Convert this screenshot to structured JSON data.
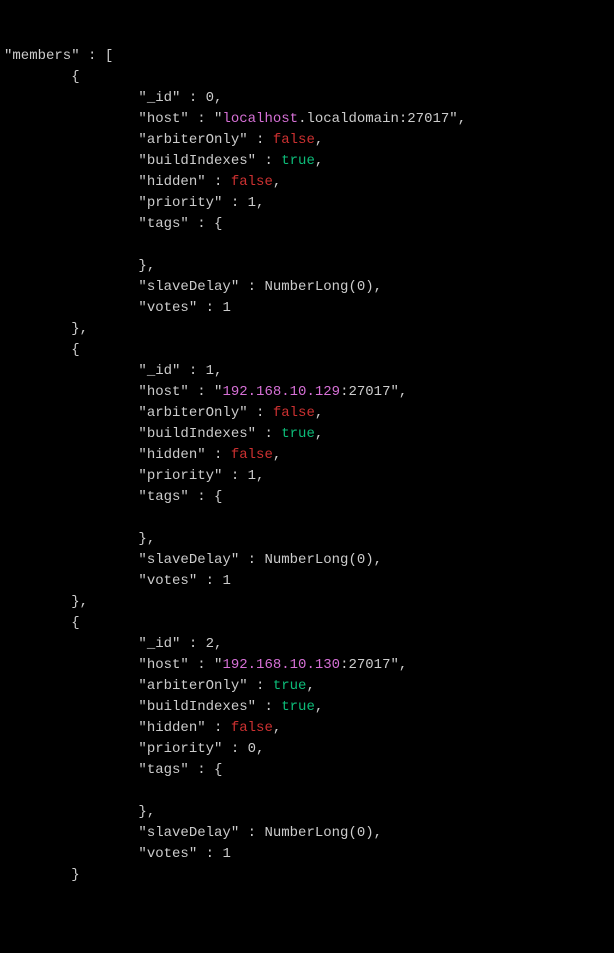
{
  "keyMembers": "\"members\"",
  "bracketOpen": "[",
  "braceOpen": "{",
  "braceClose": "}",
  "braceCloseComma": "},",
  "colon": " : ",
  "comma": ",",
  "numberlongOpen": "NumberLong(",
  "numberlongClose": ")",
  "members": [
    {
      "id_key": "\"_id\"",
      "id_val": "0",
      "host_key": "\"host\"",
      "host_q": "\"",
      "host_main": "localhost",
      "host_tail": ".localdomain:27017\"",
      "arbiterOnly_key": "\"arbiterOnly\"",
      "arbiterOnly_val": "false",
      "buildIndexes_key": "\"buildIndexes\"",
      "buildIndexes_val": "true",
      "hidden_key": "\"hidden\"",
      "hidden_val": "false",
      "priority_key": "\"priority\"",
      "priority_val": "1",
      "tags_key": "\"tags\"",
      "slaveDelay_key": "\"slaveDelay\"",
      "slaveDelay_val": "0",
      "votes_key": "\"votes\"",
      "votes_val": "1"
    },
    {
      "id_key": "\"_id\"",
      "id_val": "1",
      "host_key": "\"host\"",
      "host_q": "\"",
      "host_main": "192.168.10.129",
      "host_tail": ":27017\"",
      "arbiterOnly_key": "\"arbiterOnly\"",
      "arbiterOnly_val": "false",
      "buildIndexes_key": "\"buildIndexes\"",
      "buildIndexes_val": "true",
      "hidden_key": "\"hidden\"",
      "hidden_val": "false",
      "priority_key": "\"priority\"",
      "priority_val": "1",
      "tags_key": "\"tags\"",
      "slaveDelay_key": "\"slaveDelay\"",
      "slaveDelay_val": "0",
      "votes_key": "\"votes\"",
      "votes_val": "1"
    },
    {
      "id_key": "\"_id\"",
      "id_val": "2",
      "host_key": "\"host\"",
      "host_q": "\"",
      "host_main": "192.168.10.130",
      "host_tail": ":27017\"",
      "arbiterOnly_key": "\"arbiterOnly\"",
      "arbiterOnly_val": "true",
      "buildIndexes_key": "\"buildIndexes\"",
      "buildIndexes_val": "true",
      "hidden_key": "\"hidden\"",
      "hidden_val": "false",
      "priority_key": "\"priority\"",
      "priority_val": "0",
      "tags_key": "\"tags\"",
      "slaveDelay_key": "\"slaveDelay\"",
      "slaveDelay_val": "0",
      "votes_key": "\"votes\"",
      "votes_val": "1"
    }
  ]
}
